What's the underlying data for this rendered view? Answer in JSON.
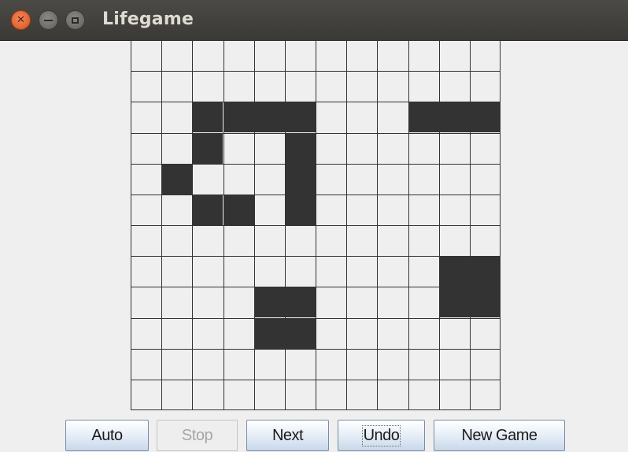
{
  "window": {
    "title": "Lifegame",
    "controls": [
      "close-icon",
      "minimize-icon",
      "maximize-icon"
    ]
  },
  "board": {
    "rows": 12,
    "cols": 12,
    "alive_color": "#333333",
    "dead_color": "#efefef",
    "grid_color": "#333333",
    "cells": [
      "............",
      "............",
      "..####...###",
      "..#..#......",
      ".#...#......",
      "..##.#......",
      "............",
      "..........##",
      "....##....##",
      "....##......",
      "............",
      "............"
    ]
  },
  "buttons": {
    "auto": "Auto",
    "stop": "Stop",
    "next": "Next",
    "undo": "Undo",
    "new_game": "New Game"
  }
}
